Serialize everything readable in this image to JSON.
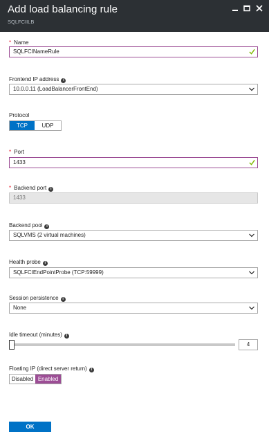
{
  "window": {
    "title": "Add load balancing rule",
    "subtitle": "SQLFCIILB"
  },
  "colors": {
    "titlebar": "#2c3034",
    "accent": "#0072c6",
    "valid_border": "#9c4d95",
    "enabled_toggle": "#9c4d95",
    "required": "#e81123",
    "checkmark": "#7fba00"
  },
  "fields": {
    "name": {
      "label": "Name",
      "value": "SQLFCINameRule",
      "required": true
    },
    "frontend_ip": {
      "label": "Frontend IP address",
      "value": "10.0.0.11 (LoadBalancerFrontEnd)"
    },
    "protocol": {
      "label": "Protocol",
      "options": [
        "TCP",
        "UDP"
      ],
      "selected": "TCP"
    },
    "port": {
      "label": "Port",
      "value": "1433",
      "required": true
    },
    "backend_port": {
      "label": "Backend port",
      "value": "1433",
      "required": true
    },
    "backend_pool": {
      "label": "Backend pool",
      "value": "SQLVMS (2 virtual machines)"
    },
    "health_probe": {
      "label": "Health probe",
      "value": "SQLFCIEndPointProbe (TCP:59999)"
    },
    "session_persistence": {
      "label": "Session persistence",
      "value": "None"
    },
    "idle_timeout": {
      "label": "Idle timeout (minutes)",
      "value": "4",
      "slider_fraction": 0.0
    },
    "floating_ip": {
      "label": "Floating IP (direct server return)",
      "options": [
        "Disabled",
        "Enabled"
      ],
      "selected": "Enabled"
    }
  },
  "footer": {
    "ok_label": "OK"
  },
  "icons": {
    "minimize": "minimize-icon",
    "maximize": "maximize-icon",
    "close": "close-icon",
    "info": "info-icon",
    "check": "check-icon",
    "chevron": "chevron-down-icon"
  }
}
